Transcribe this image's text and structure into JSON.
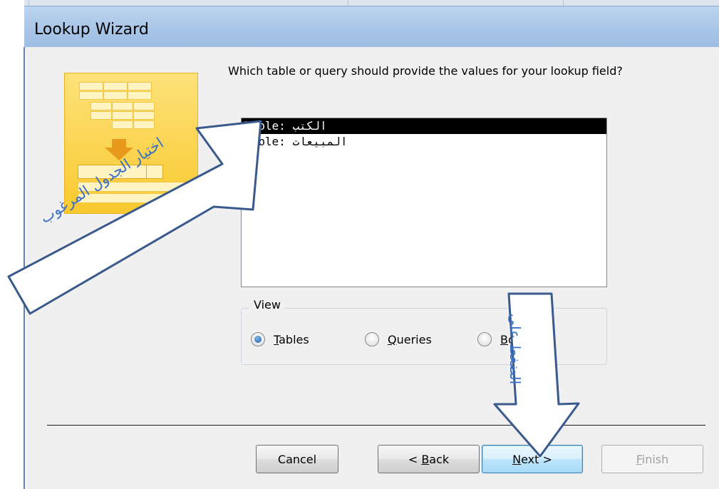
{
  "window": {
    "title": "Lookup Wizard"
  },
  "wizard": {
    "question": "Which table or query should provide the values for your lookup field?",
    "list_items": [
      {
        "label": "Table: الكتب",
        "selected": true
      },
      {
        "label": "Table: المبيعات",
        "selected": false
      }
    ],
    "view_group": {
      "label": "View",
      "options": [
        {
          "label": "Tables",
          "mnemonic": "T",
          "rest": "ables",
          "selected": true
        },
        {
          "label": "Queries",
          "mnemonic": "Q",
          "rest": "ueries",
          "selected": false
        },
        {
          "label": "Both",
          "mnemonic": "B",
          "rest": "oth",
          "selected": false
        }
      ]
    }
  },
  "buttons": {
    "cancel": "Cancel",
    "back_prefix": "< ",
    "back_mnemonic": "B",
    "back_rest": "ack",
    "next_mnemonic": "N",
    "next_rest": "ext >",
    "finish_mnemonic": "F",
    "finish_rest": "inish"
  },
  "annotations": {
    "select_table": "اختيار الجدول المرغوب",
    "click_on": "الضغط على"
  },
  "colors": {
    "title_bar": "#a9c6e8",
    "annotation": "#3b6fc6",
    "selection": "#000000"
  }
}
